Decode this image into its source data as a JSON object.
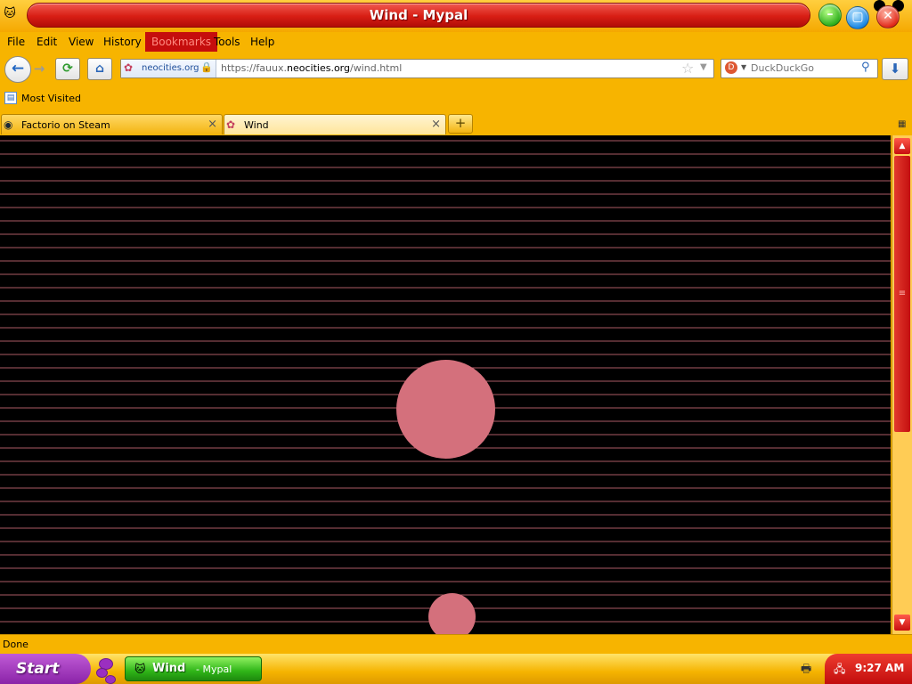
{
  "window": {
    "title": "Wind - Mypal",
    "app_icon": "mypal-logo-icon"
  },
  "menu": [
    "File",
    "Edit",
    "View",
    "History",
    "Bookmarks",
    "Tools",
    "Help"
  ],
  "menu_active": "Bookmarks",
  "nav": {
    "identity_host": "neocities.org",
    "url_prefix": "https://fauux.",
    "url_host": "neocities.org",
    "url_path": "/wind.html",
    "search_placeholder": "DuckDuckGo"
  },
  "bookmarks_bar": {
    "items": [
      "Most Visited"
    ]
  },
  "tabs": [
    {
      "label": "Factorio on Steam",
      "active": false,
      "icon": "steam-icon"
    },
    {
      "label": "Wind",
      "active": true,
      "icon": "neocities-icon"
    }
  ],
  "page": {
    "background": "#000000",
    "stripe_color": "#d4707c",
    "blob_color": "#d4707c"
  },
  "status": {
    "text": "Done"
  },
  "taskbar": {
    "start_label": "Start",
    "task_label": "Wind",
    "task_sub": " - Mypal",
    "clock": "9:27 AM"
  },
  "colors": {
    "chrome": "#f7b400",
    "title_accent": "#d81e14",
    "taskbar_active": "#2fb518"
  }
}
